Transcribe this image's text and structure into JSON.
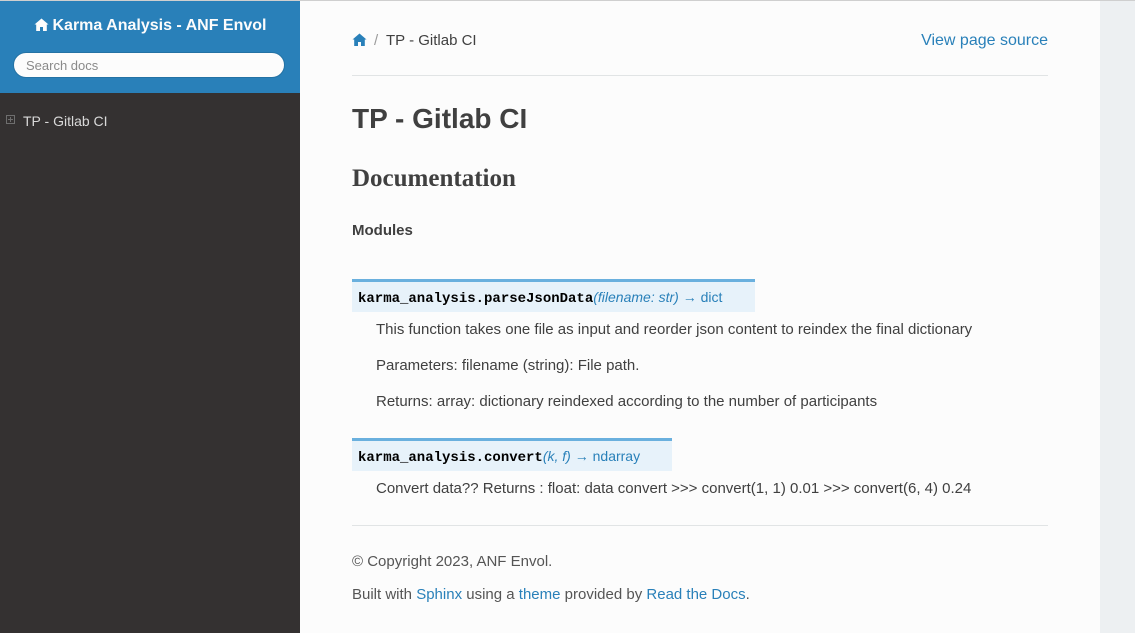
{
  "sidebar": {
    "project_title": "Karma Analysis - ANF Envol",
    "project_icon": "home-icon",
    "search_placeholder": "Search docs",
    "toc_items": [
      {
        "label": "TP - Gitlab CI",
        "icon": "expand-icon"
      }
    ]
  },
  "breadcrumbs": {
    "home_icon": "home-icon",
    "separator": "/",
    "current": "TP - Gitlab CI",
    "view_source": "View page source"
  },
  "main": {
    "title": "TP - Gitlab CI",
    "section": "Documentation",
    "subsection": "Modules",
    "functions": [
      {
        "name": "karma_analysis.parseJsonData",
        "params": "(filename: str)",
        "returns": " → dict",
        "description": [
          "This function takes one file as input and reorder json content to reindex the final dictionary",
          "Parameters: filename (string): File path.",
          "Returns: array: dictionary reindexed according to the number of participants"
        ]
      },
      {
        "name": "karma_analysis.convert",
        "params": "(k, f)",
        "returns": " → ndarray",
        "description": [
          "Convert data?? Returns : float: data convert >>> convert(1, 1) 0.01 >>> convert(6, 4) 0.24"
        ]
      }
    ]
  },
  "footer": {
    "copyright": "© Copyright 2023, ANF Envol.",
    "built_prefix": "Built with ",
    "sphinx": "Sphinx",
    "using_a": " using a ",
    "theme": "theme",
    "provided_by": " provided by ",
    "rtd": "Read the Docs",
    "period": "."
  },
  "colors": {
    "sidebar_bg": "#343131",
    "search_bg": "#2980b9",
    "link": "#2980b9",
    "signature_bg": "#e7f2fa",
    "signature_border": "#6ab0de"
  }
}
